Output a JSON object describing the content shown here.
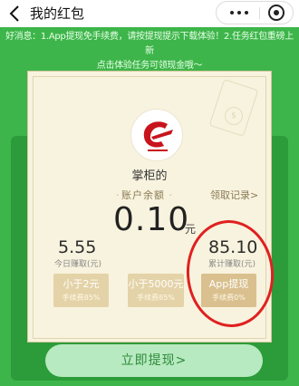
{
  "header": {
    "title": "我的红包",
    "back_icon": "back-arrow-icon",
    "more_icon": "more-dots-icon",
    "close_icon": "mini-program-close-icon"
  },
  "notice": {
    "line1": "好消息：1.App提现免手续费，请按提现提示下载体验！2.任务红包重磅上新",
    "line2": "点击体验任务可领现金哦～"
  },
  "account": {
    "username": "掌柜的",
    "balance_label": "账户余额",
    "record_link": "领取记录>",
    "balance": "0.10",
    "balance_unit": "元",
    "today_amount": "5.55",
    "today_label": "今日赚取(元)",
    "total_amount": "85.10",
    "total_label": "累计赚取(元)"
  },
  "fee_options": [
    {
      "title": "小于2元",
      "sub": "手续费85%"
    },
    {
      "title": "小于5000元",
      "sub": "手续费85%"
    },
    {
      "title": "App提现",
      "sub": "手续费0%"
    }
  ],
  "cta": {
    "label": "立即提现>"
  },
  "colors": {
    "page_bg": "#3db54a",
    "card_bg": "#f8f3de",
    "fee_button": "#e4d3a8",
    "annotation_ring": "#e02020",
    "cta_bg": "#b7eac0"
  }
}
